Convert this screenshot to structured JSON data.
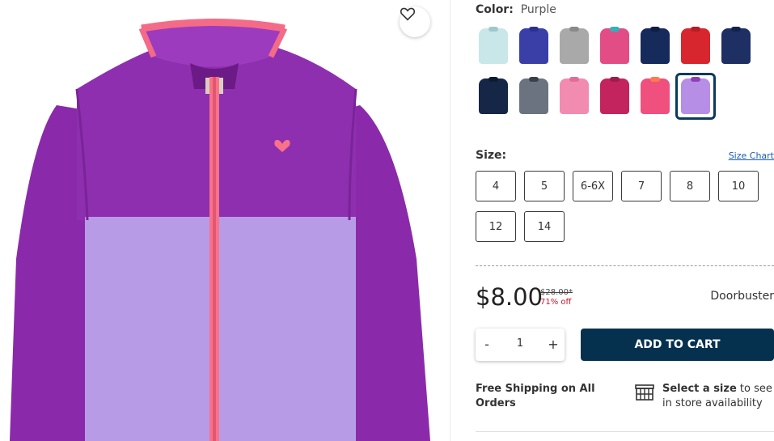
{
  "product": {
    "color_label": "Color:",
    "color_value": "Purple",
    "size_label": "Size:",
    "size_chart": "Size Chart",
    "sizes": [
      "4",
      "5",
      "6-6X",
      "7",
      "8",
      "10",
      "12",
      "14"
    ],
    "price": "$8.00",
    "original_price": "$28.00*",
    "discount": "71% off",
    "badge": "Doorbuster",
    "quantity": "1",
    "qty_minus": "-",
    "qty_plus": "+",
    "add_to_cart": "ADD TO CART",
    "shipping": "Free Shipping on All Orders",
    "store_bold": "Select a size",
    "store_rest": " to see in store availability"
  },
  "swatches": [
    {
      "body": "#c9e6e8",
      "collar": "#9fc8ce"
    },
    {
      "body": "#3a3fa8",
      "collar": "#2c3190"
    },
    {
      "body": "#a9a9a9",
      "collar": "#8a8a8a"
    },
    {
      "body": "#e24d86",
      "collar": "#2fb3b8"
    },
    {
      "body": "#172a5c",
      "collar": "#0f1d42"
    },
    {
      "body": "#d8262f",
      "collar": "#b81d25"
    },
    {
      "body": "#1e2f63",
      "collar": "#14224a"
    },
    {
      "body": "#162646",
      "collar": "#0e1a33"
    },
    {
      "body": "#6b7280",
      "collar": "#3b3f4a"
    },
    {
      "body": "#f28bb0",
      "collar": "#e06d98"
    },
    {
      "body": "#c3245e",
      "collar": "#9e1b4b"
    },
    {
      "body": "#f0507e",
      "collar": "#ff7a4d"
    },
    {
      "body": "#b78ee6",
      "collar": "#8e3fb2"
    }
  ],
  "selected_swatch": 12,
  "colors": {
    "accent_navy": "#05314f",
    "link_blue": "#1a5cb8",
    "discount_red": "#d0112b",
    "jacket_top": "#8e2fb0",
    "jacket_bottom": "#b89be6",
    "zipper_pink": "#f7728a"
  }
}
